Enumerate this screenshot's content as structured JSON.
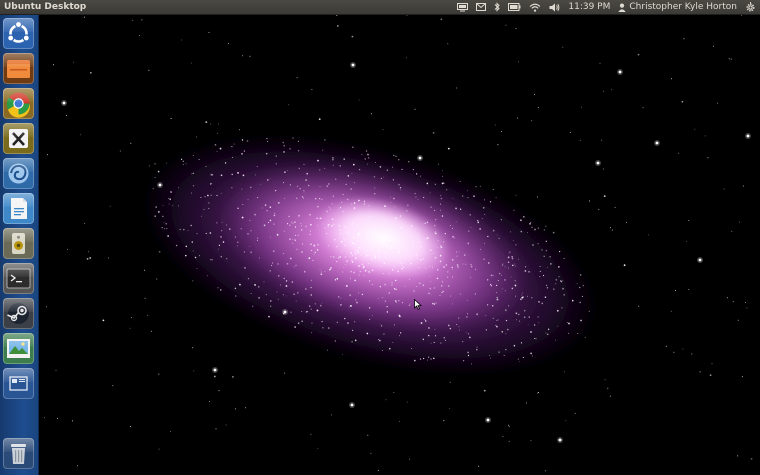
{
  "top_panel": {
    "app_title": "Ubuntu Desktop",
    "clock": "11:39 PM",
    "user_name": "Christopher Kyle Horton",
    "indicators": [
      "display-icon",
      "mail-icon",
      "bluetooth-icon",
      "battery-icon",
      "wifi-icon",
      "volume-icon",
      "user-icon",
      "gear-icon"
    ]
  },
  "launcher": {
    "items": [
      {
        "name": "dash-home"
      },
      {
        "name": "files"
      },
      {
        "name": "chrome"
      },
      {
        "name": "xchat"
      },
      {
        "name": "system-settings"
      },
      {
        "name": "libreoffice"
      },
      {
        "name": "rhythmbox"
      },
      {
        "name": "terminal"
      },
      {
        "name": "steam"
      },
      {
        "name": "image-viewer"
      },
      {
        "name": "workspace-switcher"
      },
      {
        "name": "trash"
      }
    ]
  },
  "colors": {
    "panel": "#3c3b37",
    "launcher": "#1e4d8f",
    "galaxy_core": "#ffe6ff",
    "galaxy_outer": "#7a2f8f"
  }
}
